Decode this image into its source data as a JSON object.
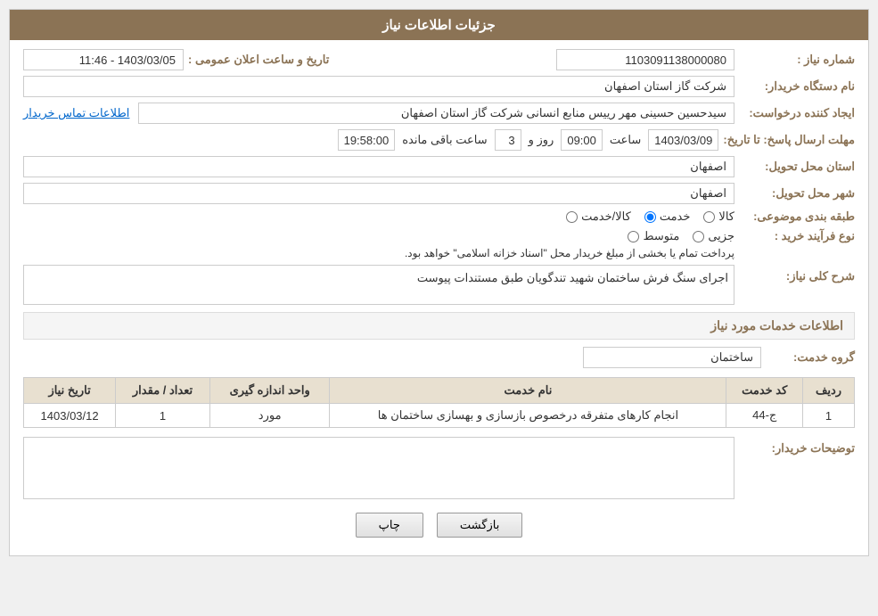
{
  "header": {
    "title": "جزئیات اطلاعات نیاز"
  },
  "fields": {
    "need_number_label": "شماره نیاز :",
    "need_number_value": "1103091138000080",
    "buyer_label": "نام دستگاه خریدار:",
    "buyer_value": "شرکت گاز استان اصفهان",
    "requester_label": "ایجاد کننده درخواست:",
    "requester_value": "سیدحسین حسینی مهر رییس منابع انسانی شرکت گاز استان اصفهان",
    "contact_link": "اطلاعات تماس خریدار",
    "deadline_label": "مهلت ارسال پاسخ: تا تاریخ:",
    "date_value": "1403/03/09",
    "time_label": "ساعت",
    "time_value": "09:00",
    "day_label": "روز و",
    "day_value": "3",
    "remaining_label": "ساعت باقی مانده",
    "remaining_value": "19:58:00",
    "public_announcement_label": "تاریخ و ساعت اعلان عمومی :",
    "public_announcement_value": "1403/03/05 - 11:46",
    "province_delivery_label": "استان محل تحویل:",
    "province_delivery_value": "اصفهان",
    "city_delivery_label": "شهر محل تحویل:",
    "city_delivery_value": "اصفهان",
    "category_label": "طبقه بندی موضوعی:",
    "category_options": [
      "کالا",
      "خدمت",
      "کالا/خدمت"
    ],
    "category_selected": "خدمت",
    "process_label": "نوع فرآیند خرید :",
    "process_options": [
      "جزیی",
      "متوسط",
      ""
    ],
    "process_note": "پرداخت تمام یا بخشی از مبلغ خریدار محل \"اسناد خزانه اسلامی\" خواهد بود.",
    "description_label": "شرح کلی نیاز:",
    "description_value": "اجرای سنگ فرش ساختمان شهید تندگویان طبق مستندات پیوست"
  },
  "services_section": {
    "title": "اطلاعات خدمات مورد نیاز",
    "group_label": "گروه خدمت:",
    "group_value": "ساختمان",
    "table": {
      "headers": [
        "ردیف",
        "کد خدمت",
        "نام خدمت",
        "واحد اندازه گیری",
        "تعداد / مقدار",
        "تاریخ نیاز"
      ],
      "rows": [
        {
          "row": "1",
          "code": "ج-44",
          "name": "انجام کارهای متفرقه درخصوص بازسازی و بهسازی ساختمان ها",
          "unit": "مورد",
          "quantity": "1",
          "date": "1403/03/12"
        }
      ]
    }
  },
  "buyer_notes": {
    "label": "توضیحات خریدار:",
    "value": ""
  },
  "buttons": {
    "print": "چاپ",
    "back": "بازگشت"
  }
}
